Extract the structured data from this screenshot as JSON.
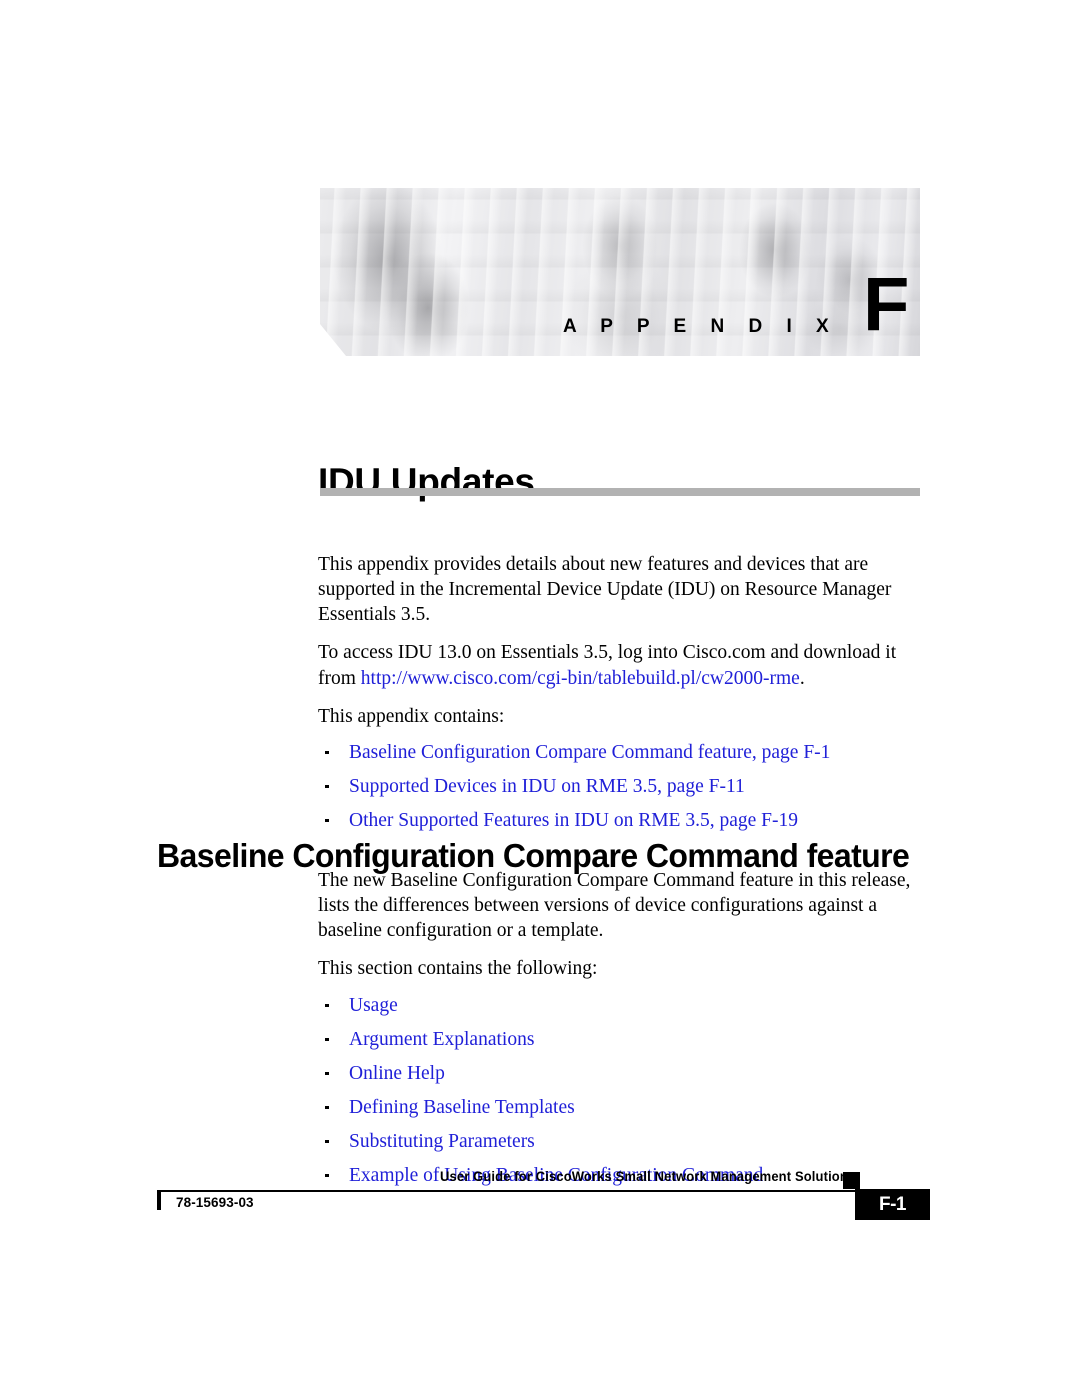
{
  "banner": {
    "appendix_word": "A P P E N D I X",
    "appendix_letter": "F"
  },
  "chapter": {
    "title": "IDU Updates"
  },
  "intro": {
    "paragraph_1": "This appendix provides details about new features and devices that are supported in the Incremental Device Update (IDU) on Resource Manager Essentials 3.5.",
    "paragraph_2_before_link": "To access IDU 13.0 on Essentials 3.5, log into Cisco.com and download it from ",
    "paragraph_2_link": "http://www.cisco.com/cgi-bin/tablebuild.pl/cw2000-rme",
    "paragraph_2_after_link": ".",
    "contains_lead_in": "This appendix contains:",
    "toc_links": [
      "Baseline Configuration Compare Command feature, page F-1",
      "Supported Devices in IDU on RME 3.5, page F-11",
      "Other Supported Features in IDU on RME 3.5, page F-19"
    ]
  },
  "section": {
    "heading": "Baseline Configuration Compare Command feature",
    "paragraph_1": "The new Baseline Configuration Compare Command feature in this release, lists the differences between versions of device configurations against a baseline configuration or a template.",
    "contains_lead_in": "This section contains the following:",
    "sub_links": [
      "Usage",
      "Argument Explanations",
      "Online Help",
      "Defining Baseline Templates",
      "Substituting Parameters",
      "Example of Using Baseline Configuration Command"
    ]
  },
  "footer": {
    "guide_title": "User Guide for CiscoWorks Small Network Management Solution",
    "doc_number": "78-15693-03",
    "page_number": "F-1"
  },
  "colors": {
    "link_blue": "#2020d8",
    "rule_gray": "#b2b2b2",
    "ink": "#000000"
  }
}
